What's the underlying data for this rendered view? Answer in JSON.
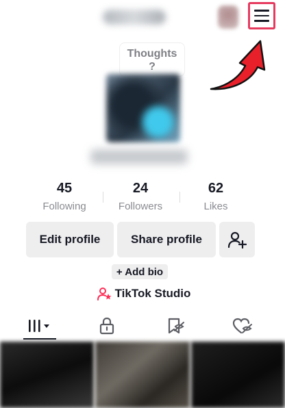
{
  "header": {
    "menu_icon": "hamburger-menu-icon",
    "highlight_color": "#e6395e"
  },
  "thoughts": {
    "line1": "Thoughts",
    "line2": "?"
  },
  "stats": [
    {
      "value": "45",
      "label": "Following"
    },
    {
      "value": "24",
      "label": "Followers"
    },
    {
      "value": "62",
      "label": "Likes"
    }
  ],
  "actions": {
    "edit_profile": "Edit profile",
    "share_profile": "Share profile",
    "add_friend_icon": "add-person-icon"
  },
  "bio": {
    "add_bio": "+ Add bio"
  },
  "studio": {
    "label": "TikTok Studio",
    "icon_color": "#fe2c55"
  },
  "tabs": [
    {
      "name": "videos-grid",
      "icon": "grid-icon"
    },
    {
      "name": "private",
      "icon": "lock-icon"
    },
    {
      "name": "favorites",
      "icon": "bookmark-icon"
    },
    {
      "name": "liked",
      "icon": "heart-icon"
    }
  ]
}
